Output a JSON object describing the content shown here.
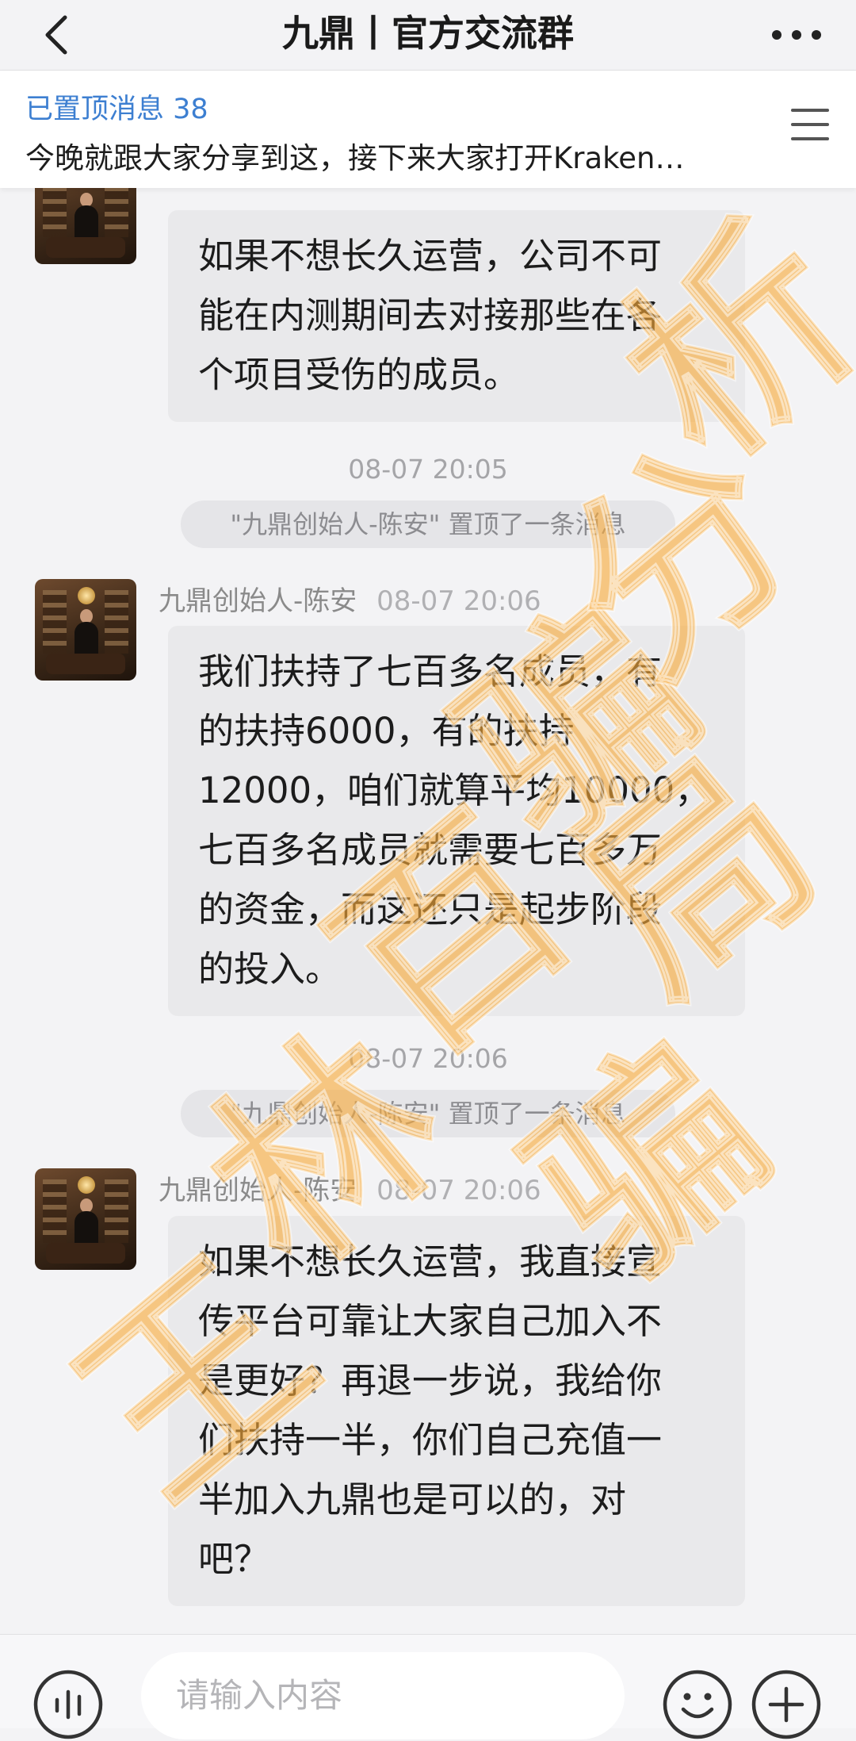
{
  "header": {
    "title": "九鼎丨官方交流群",
    "back_icon": "chevron-left-icon",
    "more_icon": "more-horizontal-icon"
  },
  "pinned": {
    "count_label": "已置顶消息 38",
    "preview": "今晚就跟大家分享到这，接下来大家打开Kraken…",
    "menu_icon": "list-menu-icon"
  },
  "messages": [
    {
      "sender": "九鼎创始人-陈安",
      "time": "08-07 20:05",
      "lines": [
        "如果不想长久运营，公司不可",
        "能在内测期间去对接那些在各",
        "个项目受伤的成员。"
      ]
    },
    {
      "sender": "九鼎创始人-陈安",
      "time": "08-07 20:06",
      "lines": [
        "我们扶持了七百多名成员，有",
        "的扶持6000，有的扶持",
        "12000，咱们就算平均10000，",
        "七百多名成员就需要七百多万",
        "的资金，而这还只是起步阶段",
        "的投入。"
      ]
    },
    {
      "sender": "九鼎创始人-陈安",
      "time": "08-07 20:06",
      "lines": [
        "如果不想长久运营，我直接宣",
        "传平台可靠让大家自己加入不",
        "是更好？再退一步说，我给你",
        "们扶持一半，你们自己充值一",
        "半加入九鼎也是可以的，对",
        "吧？"
      ]
    }
  ],
  "timestamps": [
    "08-07 20:05",
    "08-07 20:06"
  ],
  "system_notes": [
    "\"九鼎创始人-陈安\" 置顶了一条消息",
    "\"九鼎创始人-陈安\" 置顶了一条消息"
  ],
  "watermark": {
    "text": "王林百骗骗局分析",
    "color": "#f7a93a"
  },
  "input": {
    "placeholder": "请输入内容",
    "voice_icon": "voice-wave-icon",
    "emoji_icon": "emoji-smile-icon",
    "plus_icon": "plus-circle-icon"
  },
  "colors": {
    "accent": "#3d7fd1",
    "bubble": "#e9e9eb",
    "background": "#f3f3f5"
  }
}
